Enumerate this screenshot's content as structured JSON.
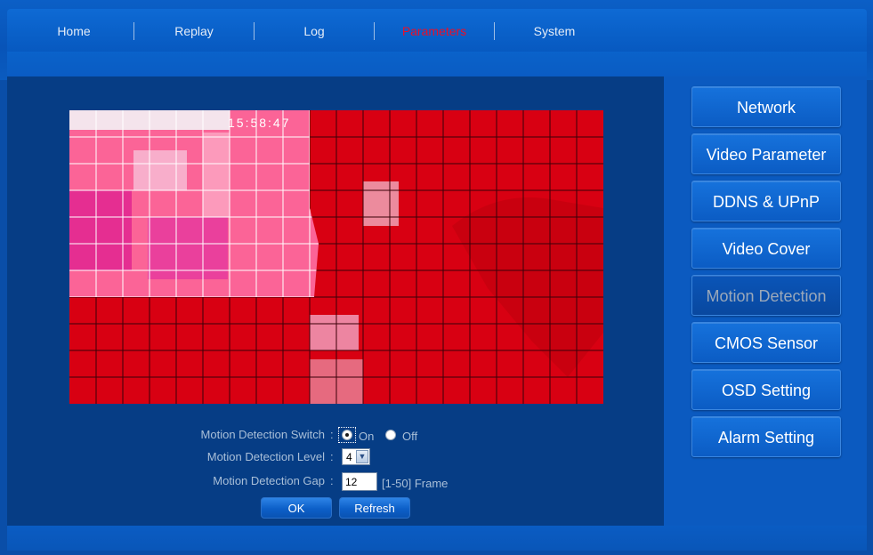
{
  "nav": {
    "items": [
      {
        "label": "Home",
        "active": false
      },
      {
        "label": "Replay",
        "active": false
      },
      {
        "label": "Log",
        "active": false
      },
      {
        "label": "Parameters",
        "active": true
      },
      {
        "label": "System",
        "active": false
      }
    ]
  },
  "video": {
    "timestamp": "15:58:47",
    "motion_grid": {
      "columns": 20,
      "rows": 11
    }
  },
  "form": {
    "switch_label": "Motion Detection Switch",
    "switch_sep": ":",
    "switch_on": "On",
    "switch_off": "Off",
    "switch_value": "On",
    "level_label": "Motion Detection Level",
    "level_sep": ":",
    "level_value": "4",
    "gap_label": "Motion Detection Gap",
    "gap_sep": ":",
    "gap_value": "12",
    "gap_hint": "[1-50] Frame"
  },
  "buttons": {
    "ok": "OK",
    "refresh": "Refresh"
  },
  "sidebar": {
    "items": [
      {
        "label": "Network",
        "active": false
      },
      {
        "label": "Video Parameter",
        "active": false
      },
      {
        "label": "DDNS & UPnP",
        "active": false
      },
      {
        "label": "Video Cover",
        "active": false
      },
      {
        "label": "Motion Detection",
        "active": true
      },
      {
        "label": "CMOS Sensor",
        "active": false
      },
      {
        "label": "OSD Setting",
        "active": false
      },
      {
        "label": "Alarm Setting",
        "active": false
      }
    ]
  },
  "colors": {
    "active_nav": "#e8102a",
    "motion_overlay": "#d70010",
    "background": "#0a4ea8"
  }
}
